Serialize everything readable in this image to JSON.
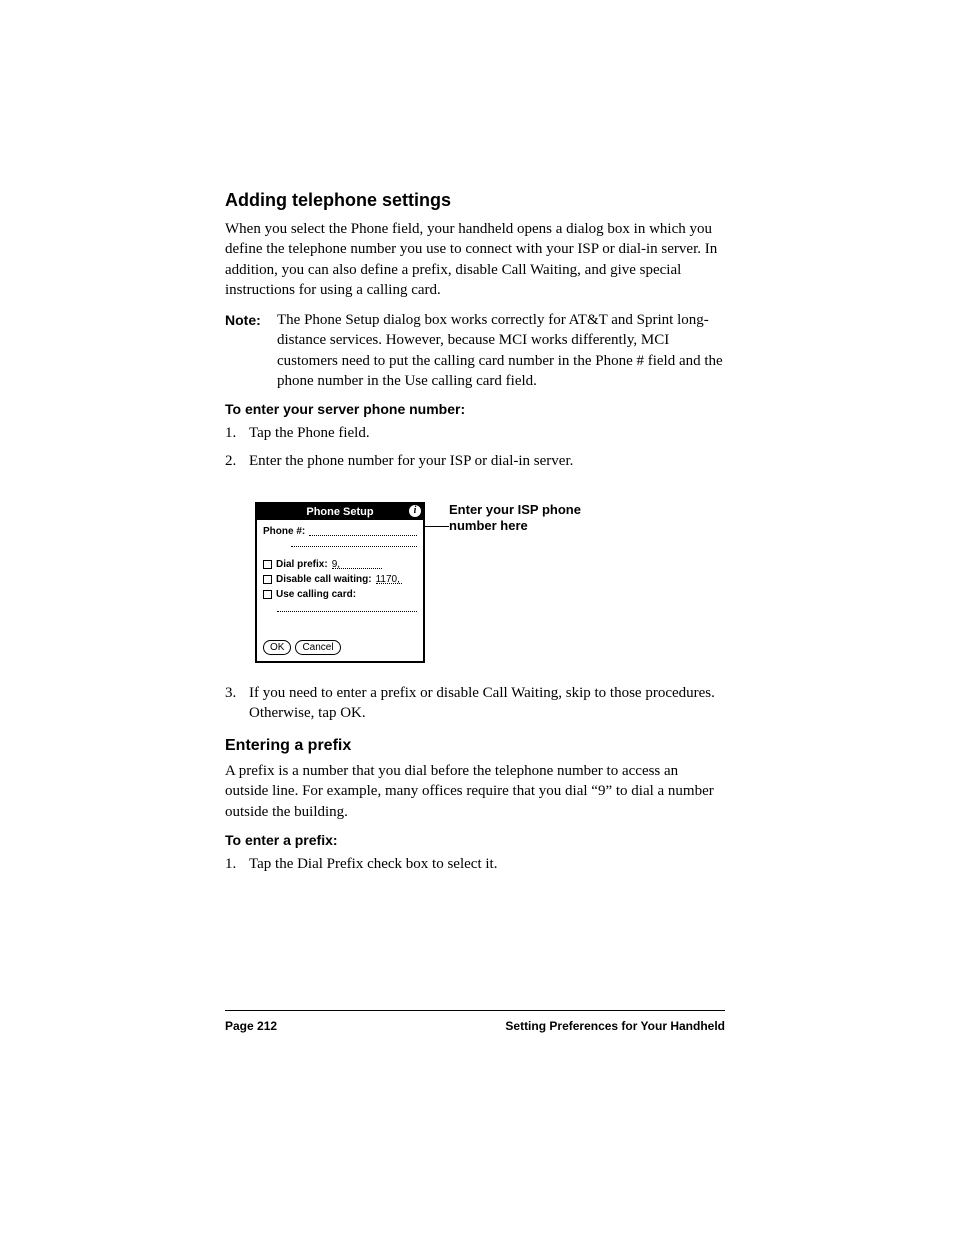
{
  "section1": {
    "title": "Adding telephone settings",
    "intro": "When you select the Phone field, your handheld opens a dialog box in which you define the telephone number you use to connect with your ISP or dial-in server. In addition, you can also define a prefix, disable Call Waiting, and give special instructions for using a calling card.",
    "note_label": "Note:",
    "note_text": "The Phone Setup dialog box works correctly for AT&T and Sprint long-distance services. However, because MCI works differently, MCI customers need to put the calling card number in the Phone # field and the phone number in the Use calling card field.",
    "proc_head": "To enter your server phone number:",
    "steps": [
      "Tap the Phone field.",
      "Enter the phone number for your ISP or dial-in server.",
      "If you need to enter a prefix or disable Call Waiting, skip to those procedures. Otherwise, tap OK."
    ]
  },
  "dialog": {
    "title": "Phone Setup",
    "phone_label": "Phone #:",
    "dial_prefix_label": "Dial prefix:",
    "dial_prefix_value": "9,",
    "disable_cw_label": "Disable call waiting:",
    "disable_cw_value": "1170,",
    "calling_card_label": "Use calling card:",
    "ok": "OK",
    "cancel": "Cancel"
  },
  "callout": "Enter your ISP phone number here",
  "section2": {
    "title": "Entering a prefix",
    "intro": "A prefix is a number that you dial before the telephone number to access an outside line. For example, many offices require that you dial “9” to dial a number outside the building.",
    "proc_head": "To enter a prefix:",
    "steps": [
      "Tap the Dial Prefix check box to select it."
    ]
  },
  "footer": {
    "page": "Page 212",
    "chapter": "Setting Preferences for Your Handheld"
  }
}
